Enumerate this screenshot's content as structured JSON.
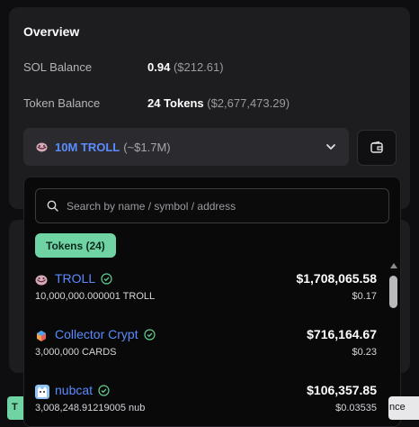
{
  "overview": {
    "title": "Overview",
    "sol_label": "SOL Balance",
    "sol_value": "0.94",
    "sol_usd": "($212.61)",
    "token_label": "Token Balance",
    "token_value": "24 Tokens",
    "token_usd": "($2,677,473.29)"
  },
  "selector": {
    "name": "10M TROLL",
    "approx": "(~$1.7M)"
  },
  "dropdown": {
    "search_placeholder": "Search by name / symbol / address",
    "tab_label": "Tokens (24)",
    "tokens": [
      {
        "name": "TROLL",
        "amount": "10,000,000.000001 TROLL",
        "usd": "$1,708,065.58",
        "price": "$0.17",
        "icon": "troll-icon"
      },
      {
        "name": "Collector Crypt",
        "amount": "3,000,000 CARDS",
        "usd": "$716,164.67",
        "price": "$0.23",
        "icon": "collector-crypt-icon"
      },
      {
        "name": "nubcat",
        "amount": "3,008,248.91219005 nub",
        "usd": "$106,357.85",
        "price": "$0.03535",
        "icon": "nubcat-icon"
      }
    ]
  },
  "edge": {
    "left_chip": "T",
    "right_chip": "nce"
  },
  "colors": {
    "accent_blue": "#5b8cff",
    "accent_green": "#6fd3a3"
  }
}
